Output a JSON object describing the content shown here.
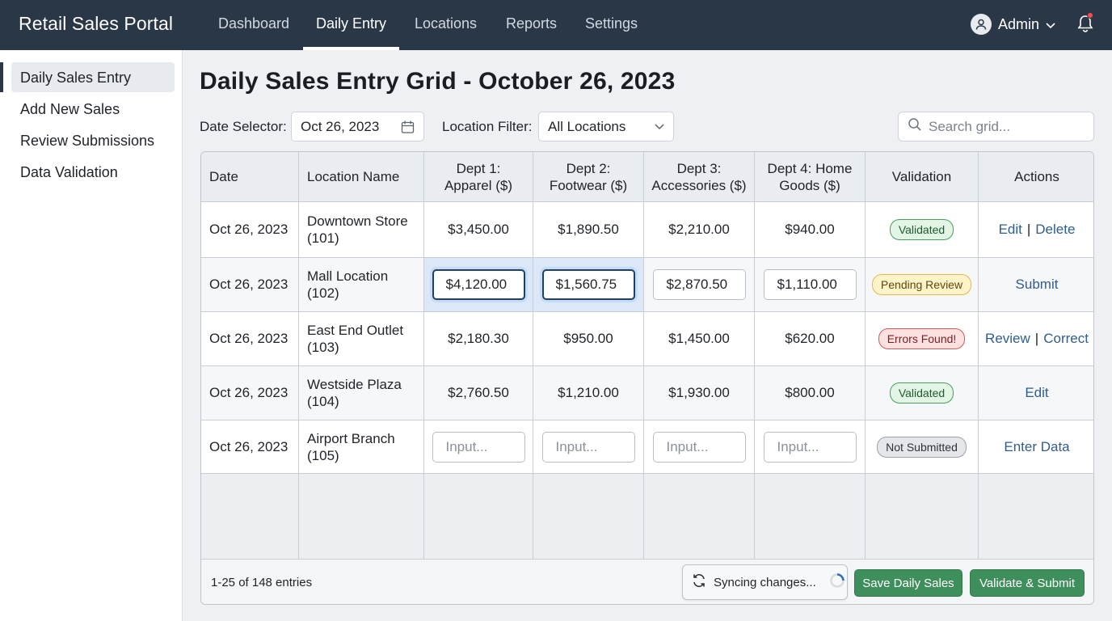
{
  "app": {
    "title": "Retail Sales Portal"
  },
  "nav": {
    "items": [
      "Dashboard",
      "Daily Entry",
      "Locations",
      "Reports",
      "Settings"
    ],
    "active": "Daily Entry"
  },
  "user": {
    "name": "Admin"
  },
  "sidebar": {
    "items": [
      "Daily Sales Entry",
      "Add New Sales",
      "Review Submissions",
      "Data Validation"
    ],
    "active": "Daily Sales Entry"
  },
  "page": {
    "title": "Daily Sales Entry Grid - October 26, 2023"
  },
  "filters": {
    "date_label": "Date Selector:",
    "date_value": "Oct 26, 2023",
    "location_label": "Location Filter:",
    "location_value": "All Locations",
    "search_placeholder": "Search grid..."
  },
  "grid": {
    "columns": [
      "Date",
      "Location Name",
      "Dept 1:|Apparel ($)",
      "Dept 2:|Footwear ($)",
      "Dept 3:|Accessories ($)",
      "Dept 4: Home|Goods ($)",
      "Validation",
      "Actions"
    ],
    "rows": [
      {
        "date": "Oct 26, 2023",
        "location": [
          "Downtown Store",
          "(101)"
        ],
        "values": [
          "$3,450.00",
          "$1,890.50",
          "$2,210.00",
          "$940.00"
        ],
        "mode": "text",
        "status": "Validated",
        "status_type": "validated",
        "actions": [
          "Edit",
          "Delete"
        ]
      },
      {
        "date": "Oct 26, 2023",
        "location": [
          "Mall Location",
          "(102)"
        ],
        "values": [
          "$4,120.00",
          "$1,560.75",
          "$2,870.50",
          "$1,110.00"
        ],
        "mode": "input",
        "status": "Pending Review",
        "status_type": "pending",
        "actions": [
          "Submit"
        ]
      },
      {
        "date": "Oct 26, 2023",
        "location": [
          "East End Outlet",
          "(103)"
        ],
        "values": [
          "$2,180.30",
          "$950.00",
          "$1,450.00",
          "$620.00"
        ],
        "mode": "text",
        "status": "Errors Found!",
        "status_type": "errors",
        "actions": [
          "Review",
          "Correct"
        ]
      },
      {
        "date": "Oct 26, 2023",
        "location": [
          "Westside Plaza",
          "(104)"
        ],
        "values": [
          "$2,760.50",
          "$1,210.00",
          "$1,930.00",
          "$800.00"
        ],
        "mode": "text",
        "status": "Validated",
        "status_type": "validated",
        "actions": [
          "Edit"
        ]
      },
      {
        "date": "Oct 26, 2023",
        "location": [
          "Airport Branch",
          "(105)"
        ],
        "values": [
          "",
          "",
          "",
          ""
        ],
        "placeholder": "Input...",
        "mode": "input",
        "status": "Not Submitted",
        "status_type": "notsub",
        "actions": [
          "Enter Data"
        ]
      }
    ]
  },
  "footer": {
    "entries": "1-25 of 148 entries",
    "sync_text": "Syncing changes...",
    "save_label": "Save Daily Sales",
    "submit_label": "Validate & Submit"
  },
  "colors": {
    "topbar": "#2a3747",
    "accent_green": "#3f8f5c",
    "link": "#2f5d8f"
  }
}
